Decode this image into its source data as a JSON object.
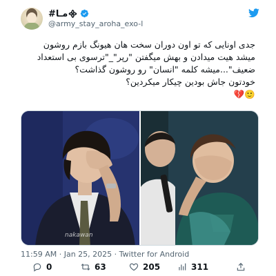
{
  "author": {
    "display_name": "#مـا᯽",
    "handle": "@army_stay_aroha_exo-l",
    "verified": true,
    "avatar_icon": "profile-avatar"
  },
  "tweet": {
    "lines": [
      "جدی اونایی که تو اون دوران سخت هان هیونگ بازم روشون",
      "میشد هیت میدادن و بهش میگفتن \"رپر\"_\"ترسوی بی استعداد",
      "ضعیف\"...میشه کلمه \"انسان\" رو روشون گذاشت؟",
      "خودتون جاش بودین چیکار میکردین؟",
      "🙂💔"
    ]
  },
  "media": {
    "watermark": "nakawan"
  },
  "meta": {
    "time": "11:59 AM",
    "separator": "·",
    "date": "Jan 25, 2025",
    "source": "Twitter for Android"
  },
  "actions": {
    "reply_count": "0",
    "retweet_count": "63",
    "like_count": "205",
    "view_count": "311"
  },
  "colors": {
    "verified": "#1d9bf0",
    "twitter_blue": "#1d9bf0",
    "like_red": "#f91880",
    "text_secondary": "#536471"
  }
}
